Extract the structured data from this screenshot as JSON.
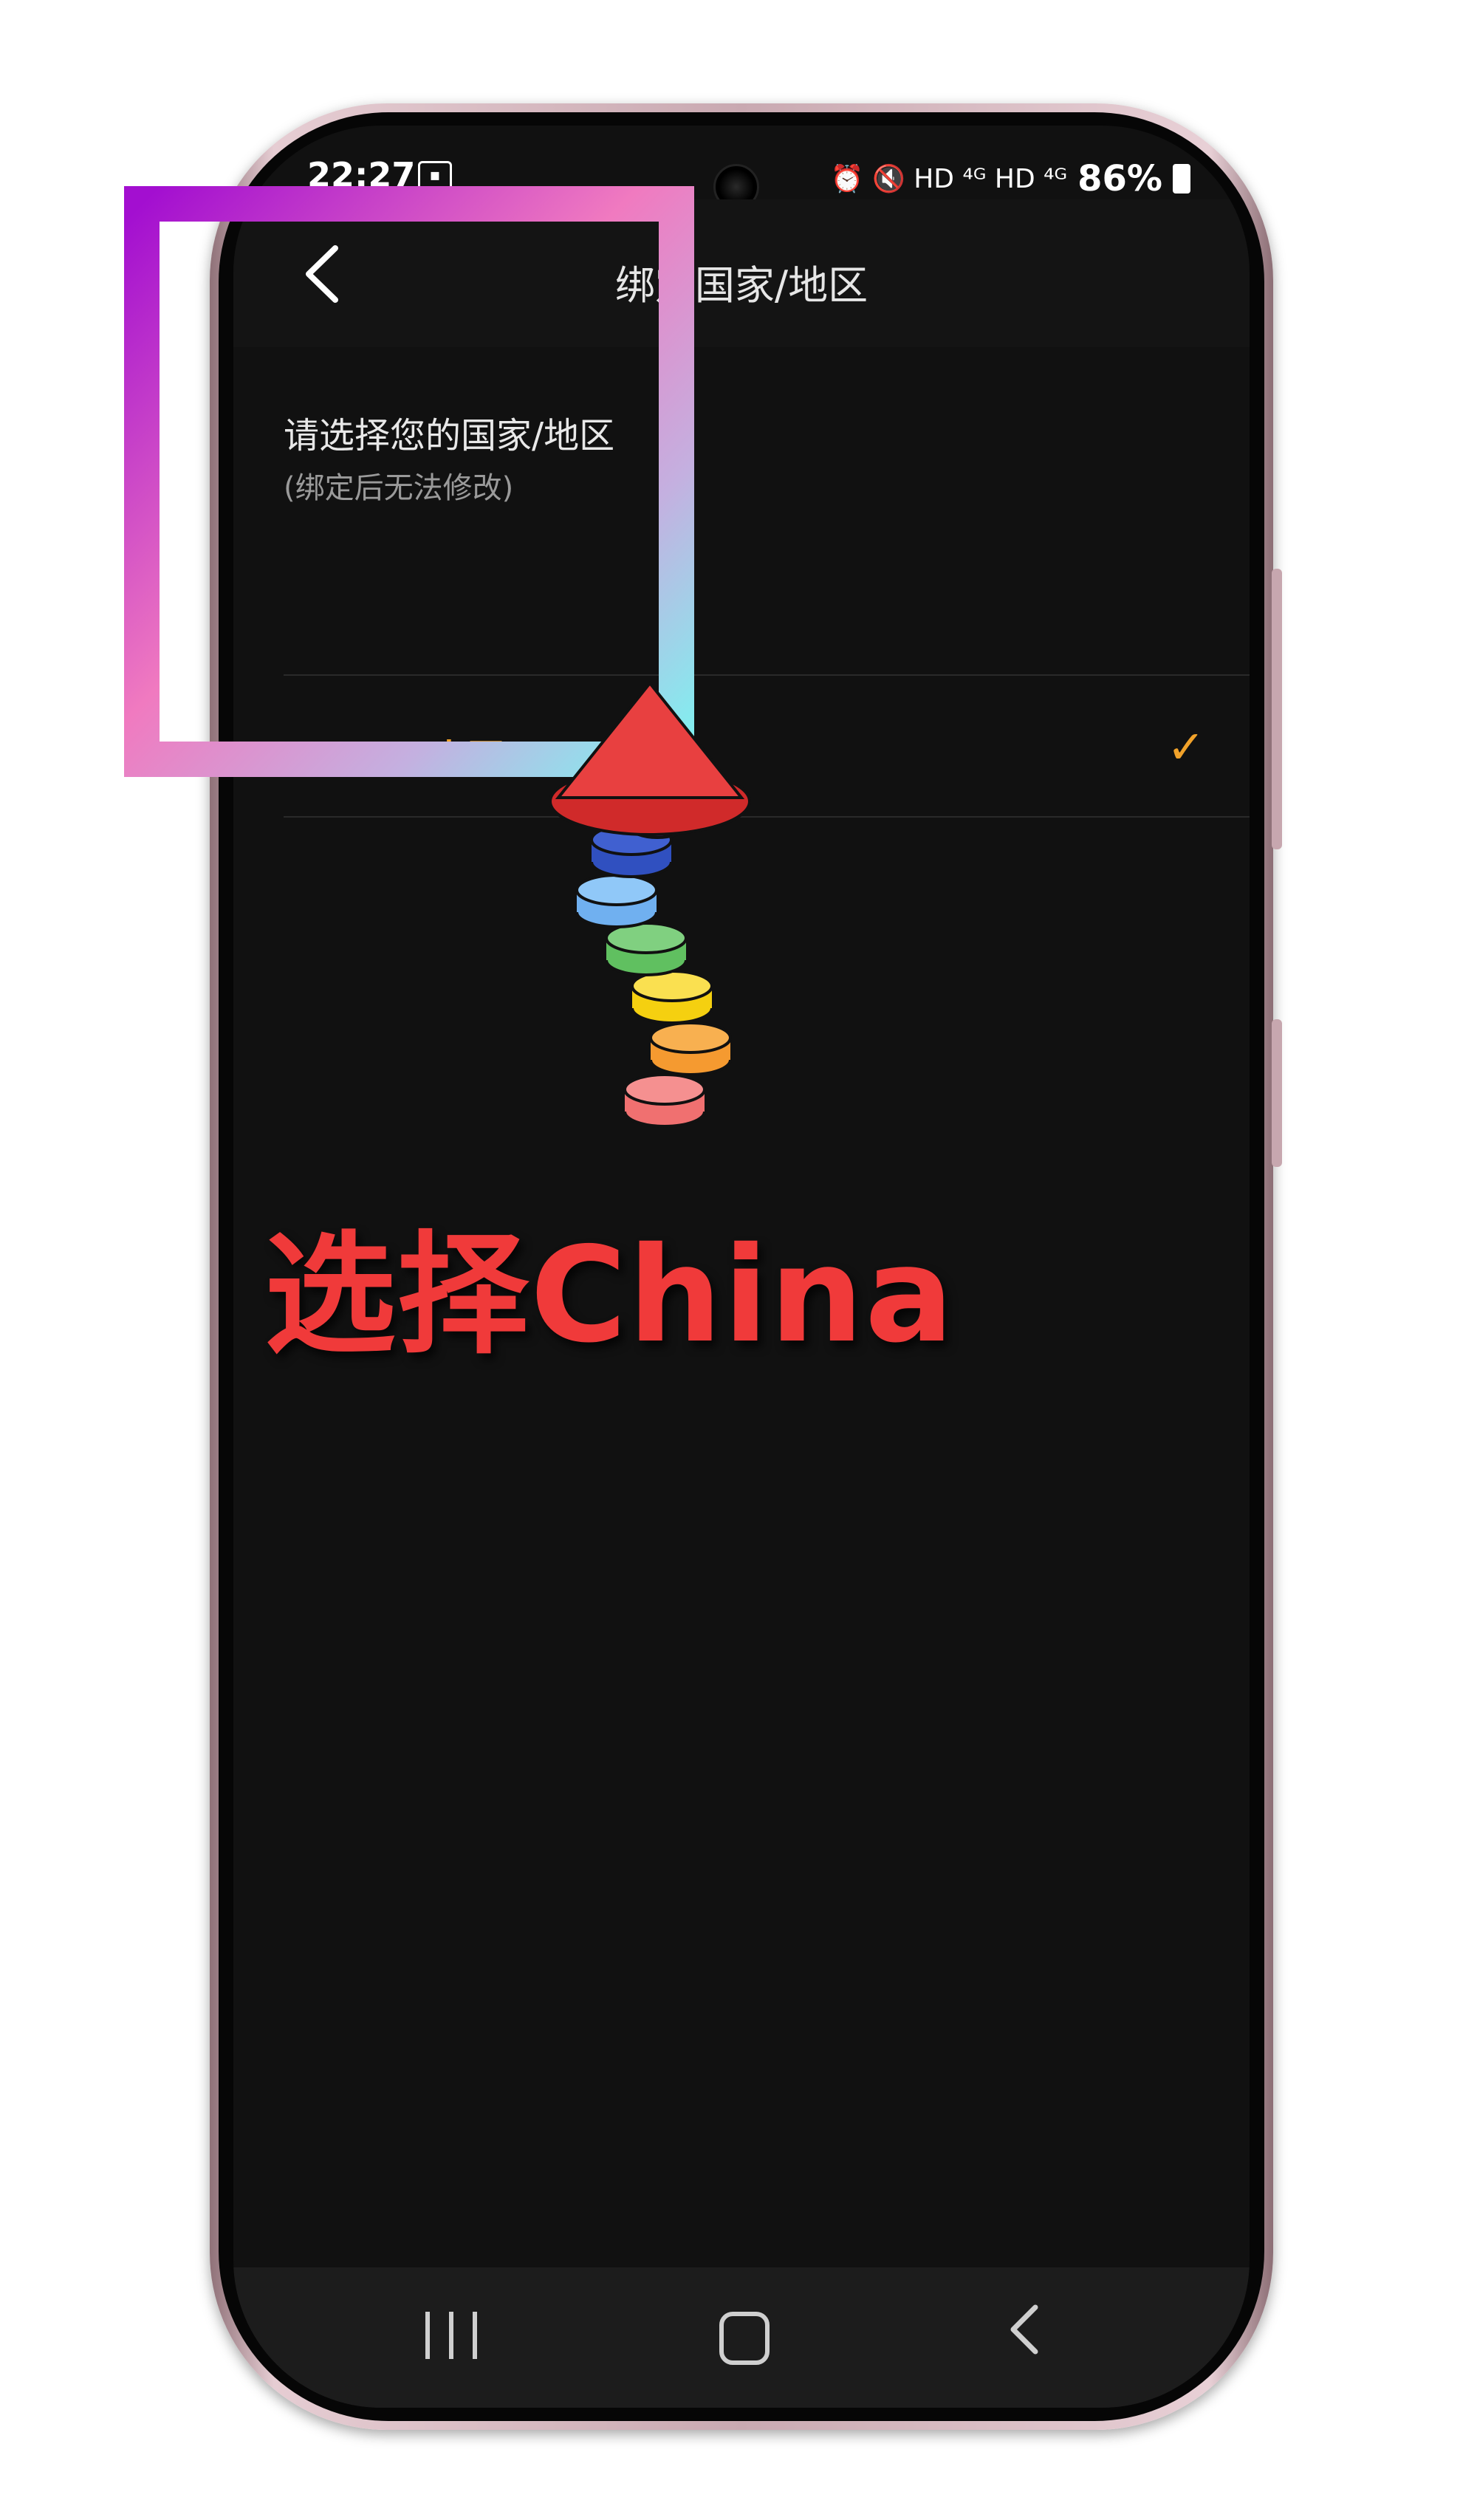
{
  "status_bar": {
    "time": "22:27",
    "indicators": "⏰ 🔇 HD ⁴ᴳ HD ⁴ᴳ",
    "battery": "86%"
  },
  "app_bar": {
    "back_icon": "‹",
    "title": "绑定国家/地区"
  },
  "content": {
    "prompt": "请选择您的国家/地区",
    "note": "(绑定后无法修改)",
    "options": [
      {
        "label": "China (中国)",
        "selected": true,
        "check_icon": "✓"
      }
    ]
  },
  "annotation": {
    "text": "选择China",
    "colors": {
      "text": "#f03a3a",
      "box_from": "#a30fd0",
      "box_to": "#80f0f0"
    }
  },
  "nav_bar": {
    "back_glyph": "‹"
  },
  "colors": {
    "accent": "#f1a22a",
    "background": "#111111"
  }
}
